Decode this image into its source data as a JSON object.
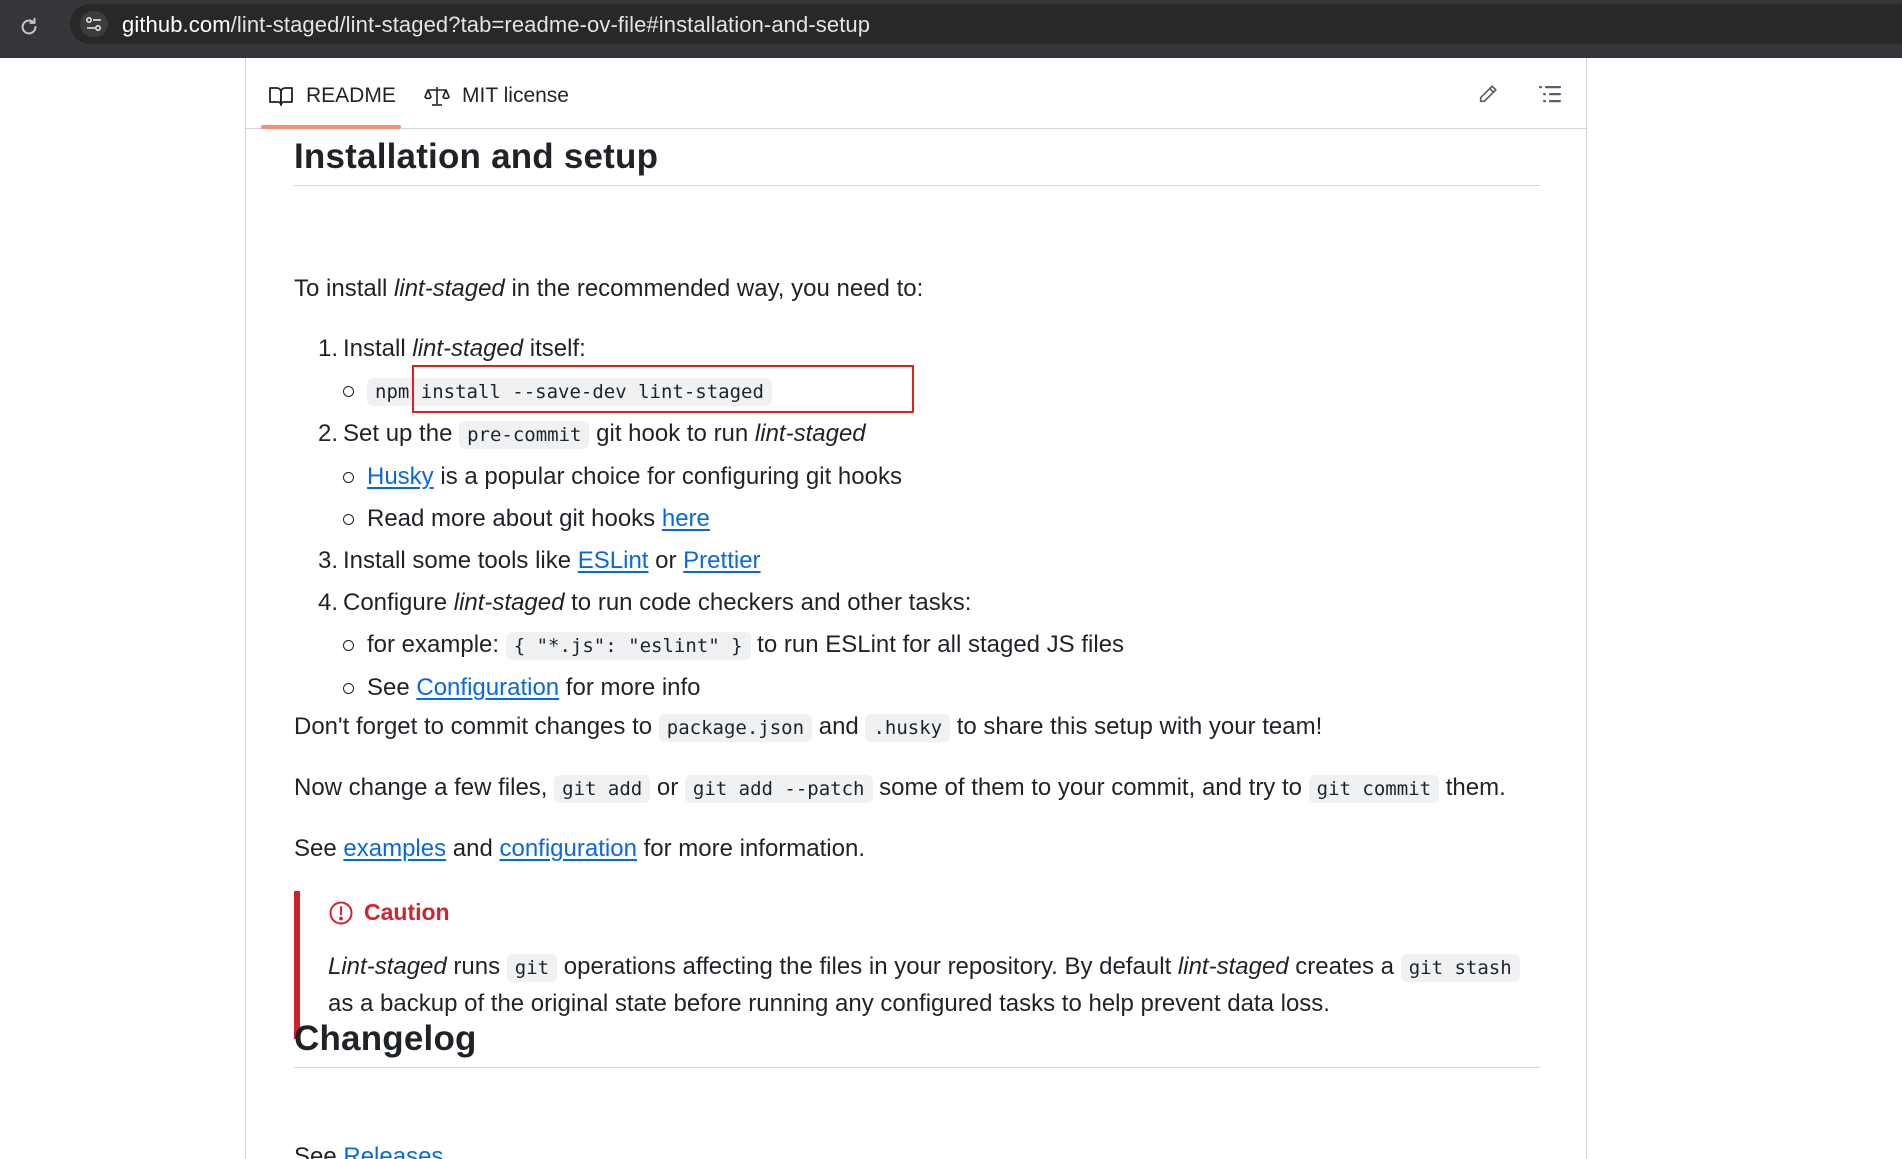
{
  "browser": {
    "url_host": "github.com",
    "url_path": "/lint-staged/lint-staged?tab=readme-ov-file#installation-and-setup"
  },
  "tabs": {
    "readme": "README",
    "license": "MIT license"
  },
  "readme": {
    "install_heading": "Installation and setup",
    "intro": {
      "pre": "To install ",
      "em": "lint-staged",
      "post": " in the recommended way, you need to:"
    },
    "steps": [
      {
        "num": "1.",
        "pre": "Install ",
        "em": "lint-staged",
        "post": " itself:",
        "sub": [
          {
            "code": "npm install --save-dev lint-staged"
          }
        ]
      },
      {
        "num": "2.",
        "pre": "Set up the ",
        "code": "pre-commit",
        "mid": " git hook to run ",
        "em": "lint-staged",
        "sub": [
          {
            "link": "Husky",
            "text": " is a popular choice for configuring git hooks"
          },
          {
            "text": "Read more about git hooks ",
            "link": "here"
          }
        ]
      },
      {
        "num": "3.",
        "pre": "Install some tools like ",
        "link1": "ESLint",
        "mid": " or ",
        "link2": "Prettier"
      },
      {
        "num": "4.",
        "pre": "Configure ",
        "em": "lint-staged",
        "post": " to run code checkers and other tasks:",
        "sub": [
          {
            "pre": "for example: ",
            "code": "{ \"*.js\": \"eslint\" }",
            "post": " to run ESLint for all staged JS files"
          },
          {
            "pre": "See ",
            "link": "Configuration",
            "post": " for more info"
          }
        ]
      }
    ],
    "commit_note": {
      "pre": "Don't forget to commit changes to ",
      "code1": "package.json",
      "mid": " and ",
      "code2": ".husky",
      "post": " to share this setup with your team!"
    },
    "now_change": {
      "pre": "Now change a few files, ",
      "code1": "git add",
      "mid1": " or ",
      "code2": "git add --patch",
      "mid2": " some of them to your commit, and try to ",
      "code3": "git commit",
      "post": " them."
    },
    "see_more": {
      "pre": "See ",
      "link1": "examples",
      "mid": " and ",
      "link2": "configuration",
      "post": " for more information."
    },
    "caution": {
      "title": "Caution",
      "em1": "Lint-staged",
      "t1": " runs ",
      "code1": "git",
      "t2": " operations affecting the files in your repository. By default ",
      "em2": "lint-staged",
      "t3": " creates a ",
      "code2": "git stash",
      "t4": " as a backup of the original state before running any configured tasks to help prevent data loss."
    },
    "changelog_heading": "Changelog",
    "releases": {
      "pre": "See ",
      "link": "Releases",
      "post": "."
    }
  },
  "colors": {
    "link": "#0969da",
    "caution_red": "#d1242f",
    "highlight_box": "#e0201a",
    "tab_underline": "#fd8c73"
  }
}
